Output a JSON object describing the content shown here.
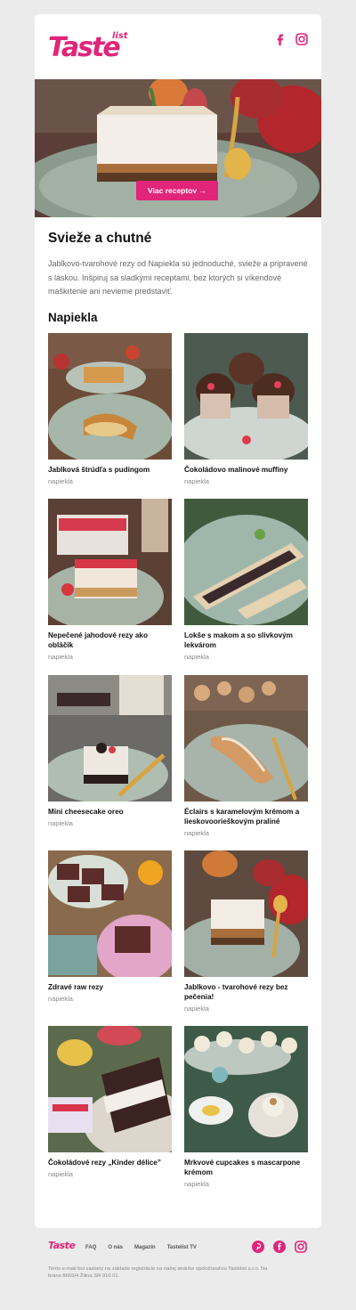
{
  "brand": {
    "logo_main": "Taste",
    "logo_small": "list"
  },
  "social": {
    "icons": [
      "facebook-icon",
      "instagram-icon",
      "pinterest-icon"
    ]
  },
  "colors": {
    "accent": "#e0257a",
    "background": "#ebebeb",
    "card": "#ffffff"
  },
  "hero": {
    "button_label": "Viac receptov →"
  },
  "main": {
    "title": "Svieže a chutné",
    "intro": "Jablkovo-tvarohové rezy od Napiekla sú jednoduché, svieže a pripravené s láskou. Inšpiruj sa sladkými receptami, bez ktorých si víkendové maškrtenie ani nevieme predstaviť.",
    "section_title": "Napiekla"
  },
  "recipes": [
    {
      "name": "Jablková štrúdľa s pudingom",
      "author": "napiekla"
    },
    {
      "name": "Čokoládovo malinové muffiny",
      "author": "napiekla"
    },
    {
      "name": "Nepečené jahodové rezy ako obláčik",
      "author": "napiekla"
    },
    {
      "name": "Lokše s makom a so slivkovým lekvárom",
      "author": "napiekla"
    },
    {
      "name": "Mini cheesecake oreo",
      "author": "napiekla"
    },
    {
      "name": "Éclairs s karamelovým krémom a lieskovoorieškovým praliné",
      "author": "napiekla"
    },
    {
      "name": "Zdravé raw rezy",
      "author": "napiekla"
    },
    {
      "name": "Jablkovo - tvarohové rezy bez pečenia!",
      "author": "napiekla"
    },
    {
      "name": "Čokoládové rezy „Kinder délice”",
      "author": "napiekla"
    },
    {
      "name": "Mrkvové cupcakes s mascarpone krémom",
      "author": "napiekla"
    }
  ],
  "footer": {
    "logo": "Taste",
    "links": [
      "FAQ",
      "O nás",
      "Magazín",
      "Tastelist TV"
    ],
    "note": "Tento e-mail bol zaslaný na základe registrácie na našej stránke spoločnosťou Tastelist s.r.o. Na bráne 8665/4 Žilina SR 010 01."
  }
}
